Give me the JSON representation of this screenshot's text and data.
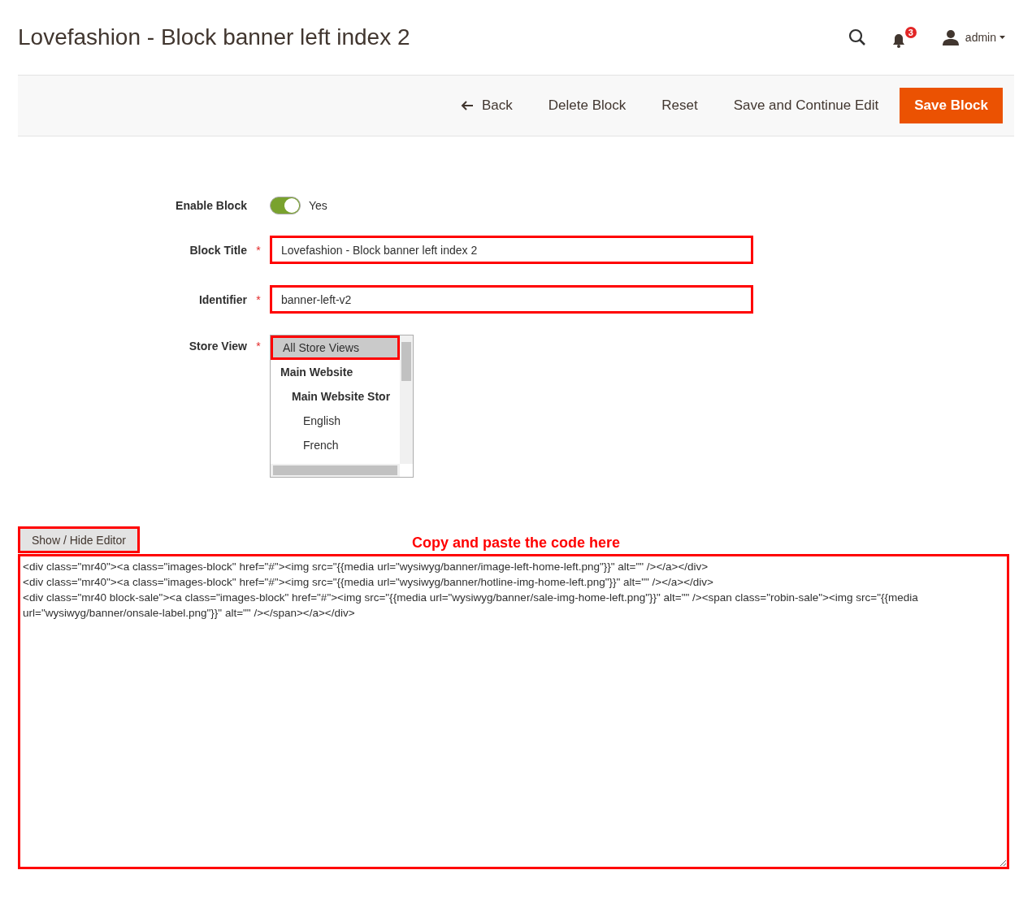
{
  "header": {
    "title": "Lovefashion - Block banner left index 2",
    "notifications": "3",
    "user": "admin"
  },
  "actions": [
    {
      "label": "Back",
      "kind": "back"
    },
    {
      "label": "Delete Block",
      "kind": "plain"
    },
    {
      "label": "Reset",
      "kind": "plain"
    },
    {
      "label": "Save and Continue Edit",
      "kind": "plain"
    },
    {
      "label": "Save Block",
      "kind": "primary"
    }
  ],
  "form": {
    "enable": {
      "label": "Enable Block",
      "on": true,
      "value": "Yes"
    },
    "fields": [
      {
        "label": "Block Title",
        "required": "*",
        "value": "Lovefashion - Block banner left index 2",
        "highlighted": true
      },
      {
        "label": "Identifier",
        "required": "*",
        "value": "banner-left-v2",
        "highlighted": true
      }
    ],
    "store_view": {
      "label": "Store View",
      "required": "*",
      "options": [
        {
          "label": "All Store Views",
          "selected": true,
          "highlighted": true
        },
        {
          "label": "Main Website",
          "selected": false,
          "children": [
            {
              "label": "Main Website Stor",
              "selected": false,
              "children": [
                {
                  "label": "English",
                  "selected": false
                },
                {
                  "label": "French",
                  "selected": false
                }
              ]
            }
          ]
        }
      ]
    }
  },
  "editor": {
    "toggle": {
      "label": "Show / Hide Editor",
      "highlighted": true
    },
    "annotation": "Copy and paste the code here",
    "highlighted": true,
    "value": "<div class=\"mr40\"><a class=\"images-block\" href=\"#\"><img src=\"{{media url=\"wysiwyg/banner/image-left-home-left.png\"}}\" alt=\"\" /></a></div>\n<div class=\"mr40\"><a class=\"images-block\" href=\"#\"><img src=\"{{media url=\"wysiwyg/banner/hotline-img-home-left.png\"}}\" alt=\"\" /></a></div>\n<div class=\"mr40 block-sale\"><a class=\"images-block\" href=\"#\"><img src=\"{{media url=\"wysiwyg/banner/sale-img-home-left.png\"}}\" alt=\"\" /><span class=\"robin-sale\"><img src=\"{{media url=\"wysiwyg/banner/onsale-label.png\"}}\" alt=\"\" /></span></a></div>"
  }
}
